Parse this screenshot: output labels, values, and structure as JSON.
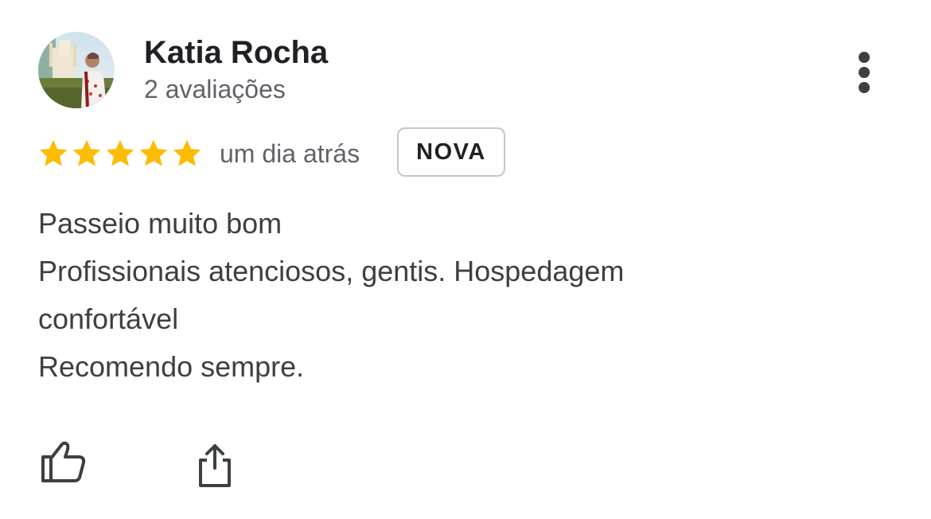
{
  "review": {
    "author_name": "Katia Rocha",
    "author_meta": "2 avaliações",
    "rating": 5,
    "rating_max": 5,
    "star_color": "#FBBC04",
    "date": "um dia atrás",
    "badge": "NOVA",
    "text_lines": [
      "Passeio muito bom",
      "Profissionais atenciosos, gentis. Hospedagem",
      "confortável",
      "Recomendo sempre."
    ]
  },
  "icons": {
    "more": "more-vertical-icon",
    "like": "thumb-up-icon",
    "share": "share-icon"
  }
}
